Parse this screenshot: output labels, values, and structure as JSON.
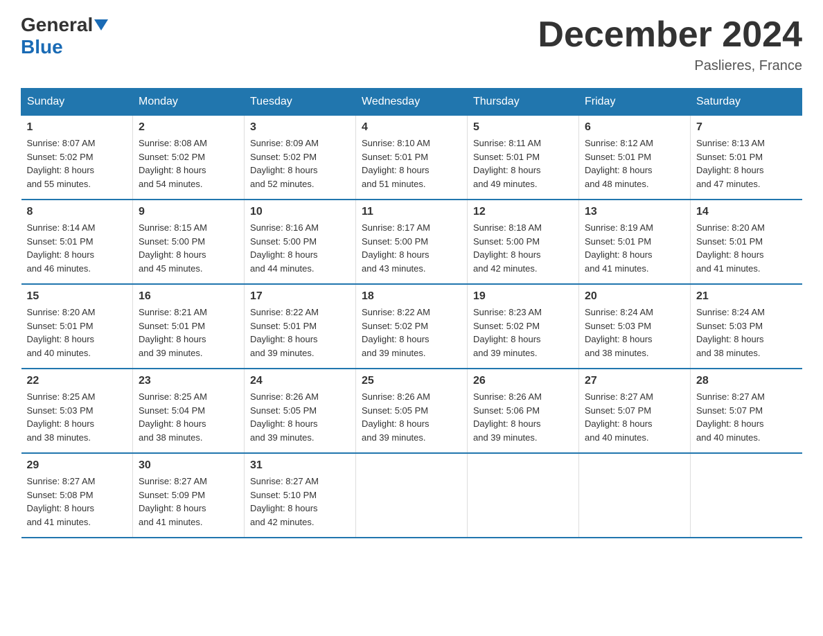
{
  "header": {
    "logo_general": "General",
    "logo_blue": "Blue",
    "month_title": "December 2024",
    "location": "Paslieres, France"
  },
  "days_of_week": [
    "Sunday",
    "Monday",
    "Tuesday",
    "Wednesday",
    "Thursday",
    "Friday",
    "Saturday"
  ],
  "weeks": [
    [
      {
        "day": "1",
        "sunrise": "8:07 AM",
        "sunset": "5:02 PM",
        "daylight": "8 hours and 55 minutes."
      },
      {
        "day": "2",
        "sunrise": "8:08 AM",
        "sunset": "5:02 PM",
        "daylight": "8 hours and 54 minutes."
      },
      {
        "day": "3",
        "sunrise": "8:09 AM",
        "sunset": "5:02 PM",
        "daylight": "8 hours and 52 minutes."
      },
      {
        "day": "4",
        "sunrise": "8:10 AM",
        "sunset": "5:01 PM",
        "daylight": "8 hours and 51 minutes."
      },
      {
        "day": "5",
        "sunrise": "8:11 AM",
        "sunset": "5:01 PM",
        "daylight": "8 hours and 49 minutes."
      },
      {
        "day": "6",
        "sunrise": "8:12 AM",
        "sunset": "5:01 PM",
        "daylight": "8 hours and 48 minutes."
      },
      {
        "day": "7",
        "sunrise": "8:13 AM",
        "sunset": "5:01 PM",
        "daylight": "8 hours and 47 minutes."
      }
    ],
    [
      {
        "day": "8",
        "sunrise": "8:14 AM",
        "sunset": "5:01 PM",
        "daylight": "8 hours and 46 minutes."
      },
      {
        "day": "9",
        "sunrise": "8:15 AM",
        "sunset": "5:00 PM",
        "daylight": "8 hours and 45 minutes."
      },
      {
        "day": "10",
        "sunrise": "8:16 AM",
        "sunset": "5:00 PM",
        "daylight": "8 hours and 44 minutes."
      },
      {
        "day": "11",
        "sunrise": "8:17 AM",
        "sunset": "5:00 PM",
        "daylight": "8 hours and 43 minutes."
      },
      {
        "day": "12",
        "sunrise": "8:18 AM",
        "sunset": "5:00 PM",
        "daylight": "8 hours and 42 minutes."
      },
      {
        "day": "13",
        "sunrise": "8:19 AM",
        "sunset": "5:01 PM",
        "daylight": "8 hours and 41 minutes."
      },
      {
        "day": "14",
        "sunrise": "8:20 AM",
        "sunset": "5:01 PM",
        "daylight": "8 hours and 41 minutes."
      }
    ],
    [
      {
        "day": "15",
        "sunrise": "8:20 AM",
        "sunset": "5:01 PM",
        "daylight": "8 hours and 40 minutes."
      },
      {
        "day": "16",
        "sunrise": "8:21 AM",
        "sunset": "5:01 PM",
        "daylight": "8 hours and 39 minutes."
      },
      {
        "day": "17",
        "sunrise": "8:22 AM",
        "sunset": "5:01 PM",
        "daylight": "8 hours and 39 minutes."
      },
      {
        "day": "18",
        "sunrise": "8:22 AM",
        "sunset": "5:02 PM",
        "daylight": "8 hours and 39 minutes."
      },
      {
        "day": "19",
        "sunrise": "8:23 AM",
        "sunset": "5:02 PM",
        "daylight": "8 hours and 39 minutes."
      },
      {
        "day": "20",
        "sunrise": "8:24 AM",
        "sunset": "5:03 PM",
        "daylight": "8 hours and 38 minutes."
      },
      {
        "day": "21",
        "sunrise": "8:24 AM",
        "sunset": "5:03 PM",
        "daylight": "8 hours and 38 minutes."
      }
    ],
    [
      {
        "day": "22",
        "sunrise": "8:25 AM",
        "sunset": "5:03 PM",
        "daylight": "8 hours and 38 minutes."
      },
      {
        "day": "23",
        "sunrise": "8:25 AM",
        "sunset": "5:04 PM",
        "daylight": "8 hours and 38 minutes."
      },
      {
        "day": "24",
        "sunrise": "8:26 AM",
        "sunset": "5:05 PM",
        "daylight": "8 hours and 39 minutes."
      },
      {
        "day": "25",
        "sunrise": "8:26 AM",
        "sunset": "5:05 PM",
        "daylight": "8 hours and 39 minutes."
      },
      {
        "day": "26",
        "sunrise": "8:26 AM",
        "sunset": "5:06 PM",
        "daylight": "8 hours and 39 minutes."
      },
      {
        "day": "27",
        "sunrise": "8:27 AM",
        "sunset": "5:07 PM",
        "daylight": "8 hours and 40 minutes."
      },
      {
        "day": "28",
        "sunrise": "8:27 AM",
        "sunset": "5:07 PM",
        "daylight": "8 hours and 40 minutes."
      }
    ],
    [
      {
        "day": "29",
        "sunrise": "8:27 AM",
        "sunset": "5:08 PM",
        "daylight": "8 hours and 41 minutes."
      },
      {
        "day": "30",
        "sunrise": "8:27 AM",
        "sunset": "5:09 PM",
        "daylight": "8 hours and 41 minutes."
      },
      {
        "day": "31",
        "sunrise": "8:27 AM",
        "sunset": "5:10 PM",
        "daylight": "8 hours and 42 minutes."
      },
      null,
      null,
      null,
      null
    ]
  ]
}
